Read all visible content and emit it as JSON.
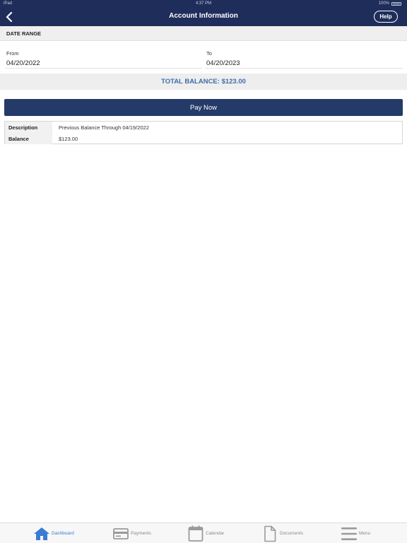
{
  "status_bar": {
    "carrier": "iPad",
    "time": "4:37 PM",
    "battery": "100%",
    "battery_level": 1.0
  },
  "header": {
    "title": "Account Information",
    "help_label": "Help"
  },
  "date_range": {
    "section_label": "DATE RANGE",
    "from_label": "From",
    "from_value": "04/20/2022",
    "to_label": "To",
    "to_value": "04/20/2023"
  },
  "summary": {
    "total_balance": "TOTAL BALANCE: $123.00"
  },
  "actions": {
    "pay_now_label": "Pay Now"
  },
  "details": {
    "description_label": "Description",
    "description_value": "Previous Balance Through 04/19/2022",
    "balance_label": "Balance",
    "balance_value": "$123.00"
  },
  "tabbar": {
    "items": [
      {
        "label": "Dashboard",
        "icon": "home-icon"
      },
      {
        "label": "Payments",
        "icon": "card-icon"
      },
      {
        "label": "Calendar",
        "icon": "calendar-icon"
      },
      {
        "label": "Documents",
        "icon": "document-icon"
      },
      {
        "label": "Menu",
        "icon": "menu-icon"
      }
    ],
    "active_index": 0
  },
  "colors": {
    "header_bg": "#1f2d5a",
    "pay_button_bg": "#243a68",
    "total_text": "#3c6ea8",
    "active_tab": "#3a7bd5",
    "inactive_tab": "#8a8a8a"
  }
}
